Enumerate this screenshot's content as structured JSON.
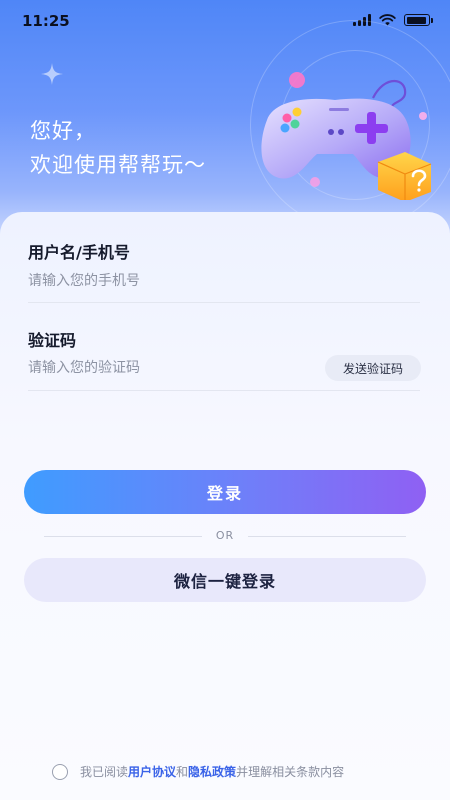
{
  "status_bar": {
    "time": "11:25",
    "battery_level": 0.95
  },
  "header": {
    "greeting_line1": "您好，",
    "greeting_line2": "欢迎使用帮帮玩～"
  },
  "form": {
    "username": {
      "label": "用户名/手机号",
      "placeholder": "请输入您的手机号",
      "value": ""
    },
    "code": {
      "label": "验证码",
      "placeholder": "请输入您的验证码",
      "value": "",
      "send_button": "发送验证码"
    }
  },
  "actions": {
    "login_label": "登录",
    "or_label": "OR",
    "wechat_label": "微信一键登录"
  },
  "agreement": {
    "prefix": "我已阅读",
    "user_agreement": "用户协议",
    "and": "和",
    "privacy_policy": "隐私政策",
    "suffix": "并理解相关条款内容",
    "checked": false
  },
  "colors": {
    "accent": "#6f7ff9",
    "gradient_start": "#3f9cff",
    "gradient_end": "#8f60f3",
    "link": "#3a63e8"
  },
  "icons": [
    "signal-icon",
    "wifi-icon",
    "battery-icon",
    "sparkle-icon",
    "gamepad-illustration",
    "question-block-icon"
  ]
}
